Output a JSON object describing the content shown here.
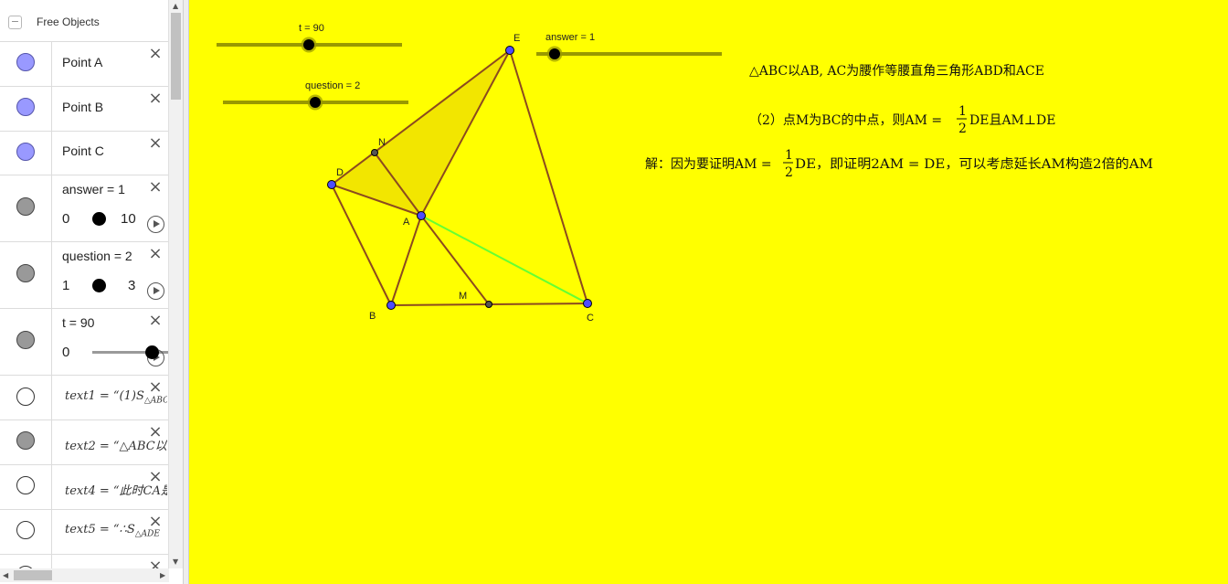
{
  "algebra": {
    "header_title": "Free Objects",
    "collapse_glyph": "−",
    "close_glyph": "×",
    "rows": [
      {
        "label": "Point A",
        "marble": "blue"
      },
      {
        "label": "Point B",
        "marble": "blue"
      },
      {
        "label": "Point C",
        "marble": "blue"
      },
      {
        "label": "answer = 1",
        "marble": "gray",
        "min": "0",
        "max": "10"
      },
      {
        "label": "question = 2",
        "marble": "gray",
        "min": "1",
        "max": "3"
      },
      {
        "label": "t = 90",
        "marble": "gray",
        "min": "0"
      },
      {
        "label": "text1 = “(1)S",
        "sub": "△ABC",
        "marble": "empty"
      },
      {
        "label": "text2 = “△ABC以",
        "marble": "gray"
      },
      {
        "label": "text4 = “此时CA是",
        "marble": "empty"
      },
      {
        "label": "text5 = “∴S",
        "sub": "△ADE",
        "marble": "empty"
      }
    ]
  },
  "sliders": {
    "t": {
      "label": "t = 90",
      "value": 90,
      "min": 0,
      "max": 180
    },
    "question": {
      "label": "question = 2",
      "value": 2,
      "min": 1,
      "max": 3
    },
    "answer": {
      "label": "answer = 1",
      "value": 1,
      "min": 0,
      "max": 10
    }
  },
  "points": {
    "A": "A",
    "B": "B",
    "C": "C",
    "D": "D",
    "E": "E",
    "M": "M",
    "N": "N"
  },
  "texts": {
    "line1": "△ABC以AB, AC为腰作等腰直角三角形ABD和ACE",
    "line2_prefix": "（2）点M为BC的中点，则AM = ",
    "line2_frac_num": "1",
    "line2_frac_den": "2",
    "line2_suffix": "DE且AM⊥DE",
    "line3_prefix": "解：因为要证明AM = ",
    "line3_frac_num": "1",
    "line3_frac_den": "2",
    "line3_suffix": "DE，即证明2AM = DE，可以考虑延长AM构造2倍的AM"
  },
  "colors": {
    "background": "#ffff00",
    "segment": "#8b4a1f",
    "polygon_fill": "#f2e600",
    "highlight_segment": "#66ff33",
    "point_free": "#4d4dff",
    "point_dependent": "#555555"
  }
}
